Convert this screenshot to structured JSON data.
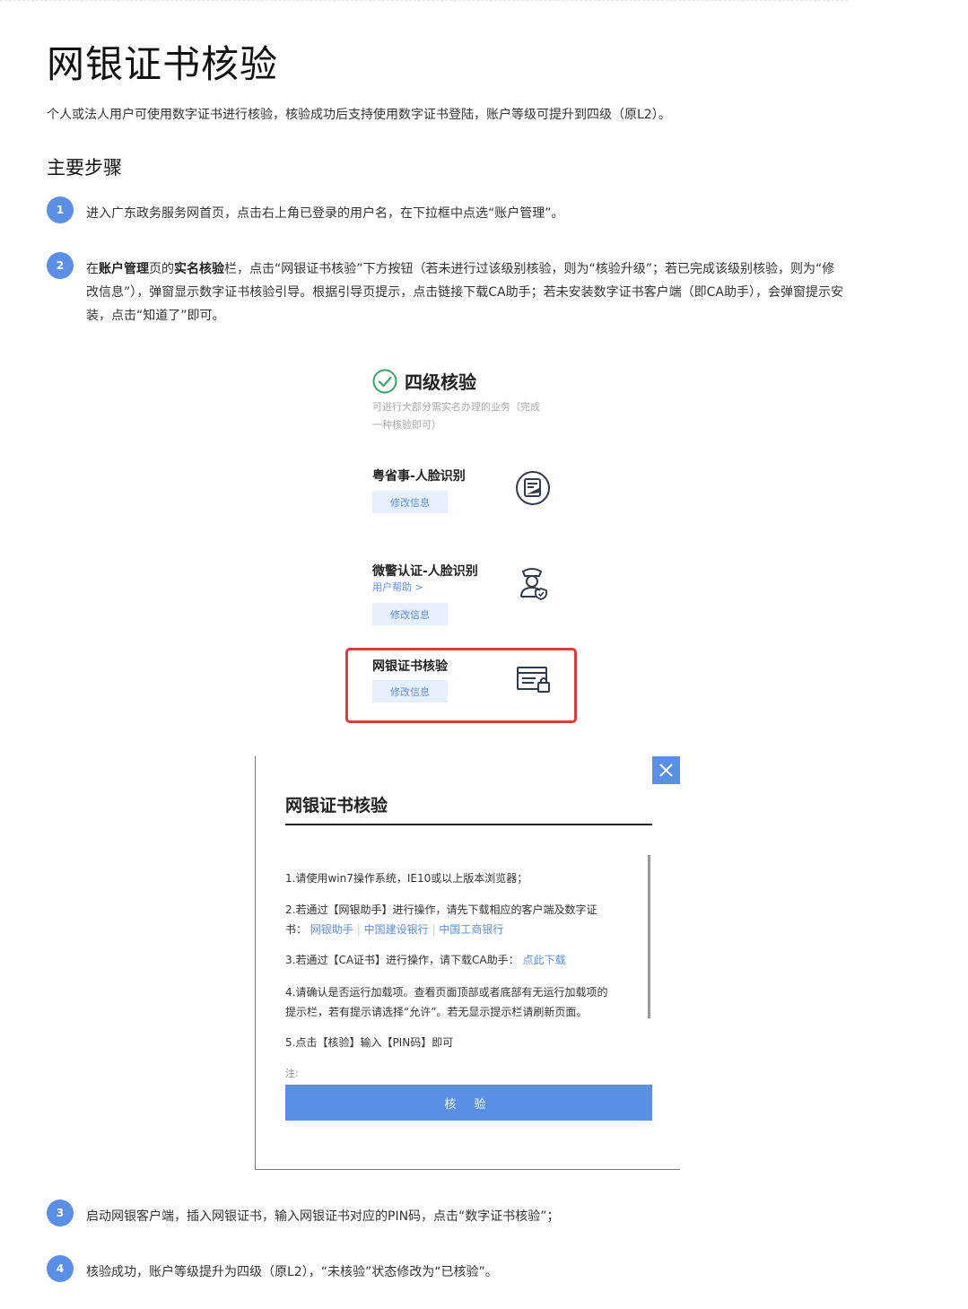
{
  "page": {
    "title": "网银证书核验",
    "intro": "个人或法人用户可使用数字证书进行核验，核验成功后支持使用数字证书登陆，账户等级可提升到四级（原L2）。",
    "section_title": "主要步骤"
  },
  "steps": [
    {
      "num": "1",
      "text": "进入广东政务服务网首页，点击右上角已登录的用户名，在下拉框中点选“账户管理”。"
    },
    {
      "num": "2",
      "text_a": "在",
      "bold_a": "账户管理",
      "text_b": "页的",
      "bold_b": "实名核验",
      "text_c": "栏，点击“网银证书核验”下方按钮（若未进行过该级别核验，则为“核验升级”；若已完成该级别核验，则为“修改信息”），弹窗显示数字证书核验引导。根据引导页提示，点击链接下载CA助手；若未安装数字证书客户端（即CA助手），会弹窗提示安装，点击“知道了”即可。"
    },
    {
      "num": "3",
      "text": "启动网银客户端，插入网银证书，输入网银证书对应的PIN码，点击“数字证书核验”；"
    },
    {
      "num": "4",
      "text": "核验成功，账户等级提升为四级（原L2），“未核验”状态修改为“已核验”。"
    }
  ],
  "figure1": {
    "level_title": "四级核验",
    "level_desc_line1": "可进行大部分需实名办理的业务（完成",
    "level_desc_line2": "一种核验即可）",
    "methods": [
      {
        "name": "粤省事-人脸识别",
        "button": "修改信息",
        "icon": "face-scan-icon"
      },
      {
        "name": "微警认证-人脸识别",
        "help": "用户帮助 >",
        "button": "修改信息",
        "icon": "police-officer-icon"
      },
      {
        "name": "网银证书核验",
        "button": "修改信息",
        "icon": "certificate-lock-icon",
        "highlighted": true
      }
    ],
    "highlight_color": "#e03b3b"
  },
  "dialog": {
    "title": "网银证书核验",
    "line1": "1.请使用win7操作系统，IE10或以上版本浏览器；",
    "line2a": "2.若通过【网银助手】进行操作，请先下载相应的客户端及数字证",
    "line2b": "书：",
    "line2_links": [
      "网银助手",
      "中国建设银行",
      "中国工商银行"
    ],
    "line2_sep": "|",
    "line3": "3.若通过【CA证书】进行操作，请下载CA助手：",
    "line3_link": "点此下载",
    "line4a": "4.请确认是否运行加载项。查看页面顶部或者底部有无运行加载项的",
    "line4b": "提示栏，若有提示请选择“允许”。若无显示提示栏请刷新页面。",
    "line5": "5.点击【核验】输入【PIN码】即可",
    "note": "注:",
    "submit": "核 验",
    "close_icon": "close-icon"
  },
  "colors": {
    "accent": "#5b8fe5",
    "button_bg_light": "#e6f0fc",
    "highlight": "#e03b3b"
  }
}
